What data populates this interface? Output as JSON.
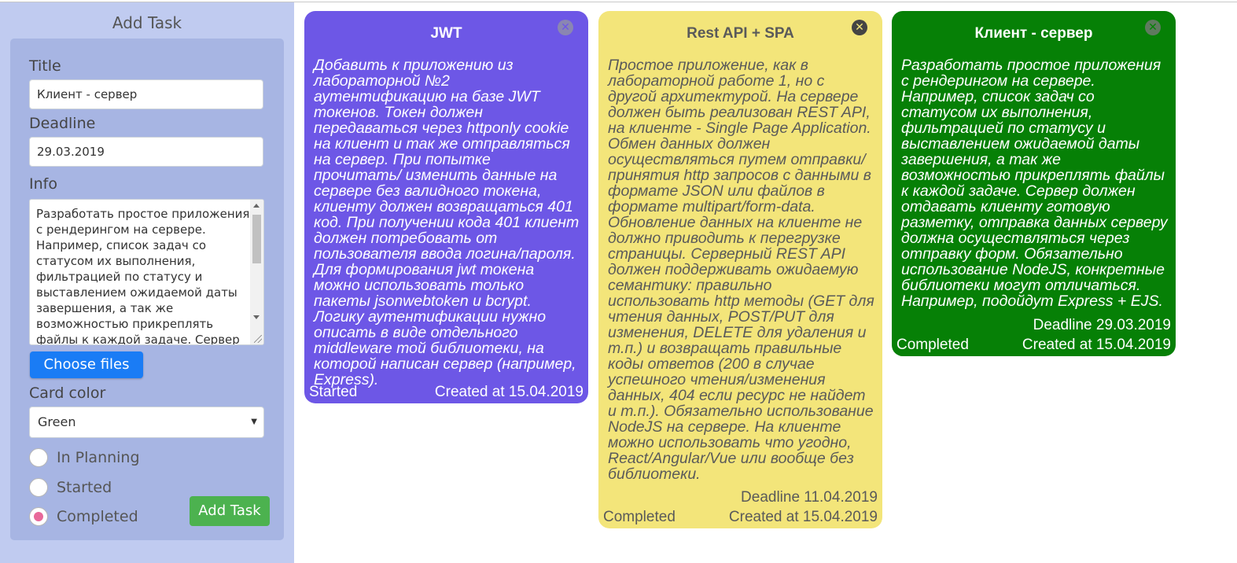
{
  "sidebar": {
    "title": "Add Task",
    "title_label": "Title",
    "title_value": "Клиент - сервер",
    "deadline_label": "Deadline",
    "deadline_value": "29.03.2019",
    "info_label": "Info",
    "info_value": "Разработать простое приложения с рендерингом на сервере. Например, список задач со статусом их выполнения, фильтрацией по статусу и выставлением ожидаемой даты завершения, а так же возможностью прикреплять файлы к каждой задаче. Сервер",
    "choose_files_label": "Choose files",
    "card_color_label": "Card color",
    "card_color_selected": "Green",
    "status_options": [
      "In Planning",
      "Started",
      "Completed"
    ],
    "status_selected": "Completed",
    "add_button_label": "Add Task"
  },
  "cards": [
    {
      "title": "JWT",
      "body": "Добавить к приложению из лабораторной №2 аутентификацию на базе JWT токенов. Токен должен передаваться через httponly cookie на клиент и так же отправляться на сервер. При попытке прочитать/ изменить данные на сервере без валидного токена, клиенту должен возвращаться 401 код. При получении кода 401 клиент должен потребовать от пользователя ввода логина/пароля. Для формирования jwt токена можно использовать только пакеты jsonwebtoken и bcrypt. Логику аутентификации нужно описать в виде отдельного middleware той библиотеки, на которой написан сервер (например, Express).",
      "deadline": "",
      "status": "Started",
      "created": "Created at 15.04.2019",
      "color": "#6d57e6"
    },
    {
      "title": "Rest API + SPA",
      "body": "Простое приложение, как в лабораторной работе 1, но с другой архитектурой. На сервере должен быть реализован REST API, на клиенте - Single Page Application. Обмен данных должен осуществляться путем отправки/ принятия http запросов с данными в формате JSON или файлов в формате multipart/form-data. Обновление данных на клиенте не должно приводить к перегрузке страницы. Серверный REST API должен поддерживать ожидаемую семантику: правильно использовать http методы (GET для чтения данных, POST/PUT для изменения, DELETE для удаления и т.п.) и возвращать правильные коды ответов (200 в случае успешного чтения/изменения данных, 404 если ресурс не найдет и т.п.). Обязательно использование NodeJS на сервере. На клиенте можно использовать что угодно, React/Angular/Vue или вообще без библиотеки.",
      "deadline": "Deadline 11.04.2019",
      "status": "Completed",
      "created": "Created at 15.04.2019",
      "color": "#f3e57a"
    },
    {
      "title": "Клиент - сервер",
      "body": "Разработать простое приложения с рендерингом на сервере. Например, список задач со статусом их выполнения, фильтрацией по статусу и выставлением ожидаемой даты завершения, а так же возможностью прикреплять файлы к каждой задаче. Сервер должен отдавать клиенту готовую разметку, отправка данных серверу должна осуществляться через отправку форм. Обязательно использование NodeJS, конкретные библиотеки могут отличаться. Например, подойдут Express + EJS.",
      "deadline": "Deadline 29.03.2019",
      "status": "Completed",
      "created": "Created at 15.04.2019",
      "color": "#068006"
    }
  ],
  "icons": {
    "close": "close-icon",
    "select_caret": "chevron-down-icon"
  }
}
